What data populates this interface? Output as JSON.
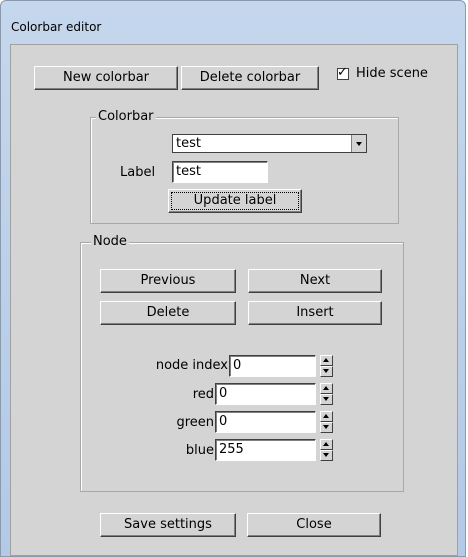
{
  "window": {
    "title": "Colorbar editor"
  },
  "toolbar": {
    "new_colorbar": "New colorbar",
    "delete_colorbar": "Delete colorbar",
    "hide_scene_label": "Hide scene",
    "hide_scene_checked": true
  },
  "colorbar_group": {
    "legend": "Colorbar",
    "selected": "test",
    "label_caption": "Label",
    "label_value": "test",
    "update_button": "Update label"
  },
  "node_group": {
    "legend": "Node",
    "previous": "Previous",
    "next": "Next",
    "delete": "Delete",
    "insert": "Insert",
    "fields": [
      {
        "label": "node index",
        "value": "0"
      },
      {
        "label": "red",
        "value": "0"
      },
      {
        "label": "green",
        "value": "0"
      },
      {
        "label": "blue",
        "value": "255"
      }
    ]
  },
  "footer": {
    "save_settings": "Save settings",
    "close": "Close"
  }
}
